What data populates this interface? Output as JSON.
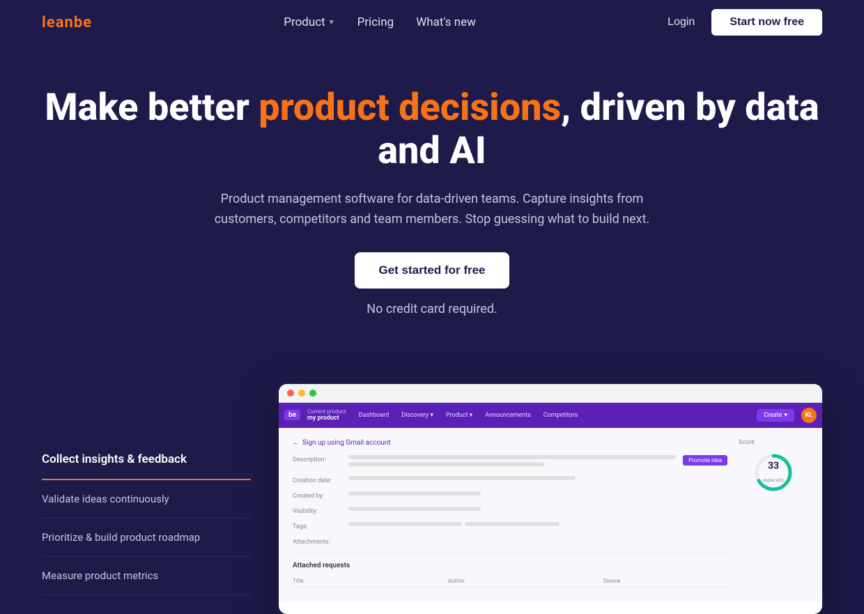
{
  "brand": {
    "name_part1": "lean",
    "name_part2": "be"
  },
  "nav": {
    "product_label": "Product",
    "pricing_label": "Pricing",
    "whats_new_label": "What's new",
    "login_label": "Login",
    "start_label": "Start now free"
  },
  "hero": {
    "headline_part1": "Make better ",
    "headline_highlight": "product decisions",
    "headline_part2": ", driven by data and AI",
    "subtext": "Product management software for data-driven teams. Capture insights from customers, competitors and team members. Stop guessing what to build next.",
    "cta_label": "Get started for free",
    "no_credit": "No credit card required."
  },
  "features": {
    "items": [
      {
        "label": "Collect insights & feedback",
        "active": true
      },
      {
        "label": "Validate ideas continuously",
        "active": false
      },
      {
        "label": "Prioritize & build product roadmap",
        "active": false
      },
      {
        "label": "Measure product metrics",
        "active": false
      }
    ]
  },
  "app_mockup": {
    "nav": {
      "logo": "be",
      "product_label": "Current product",
      "product_name": "my product",
      "items": [
        "Dashboard",
        "Discovery",
        "Product",
        "Announcements",
        "Competitors"
      ],
      "create_label": "Create",
      "avatar": "KL"
    },
    "form": {
      "back_label": "Sign up using Gmail account",
      "score_label": "Score",
      "score_value": "33",
      "score_more": "more info",
      "description_label": "Description:",
      "creation_date_label": "Creation date:",
      "created_by_label": "Created by:",
      "visibility_label": "Visibility:",
      "tags_label": "Tags:",
      "attachments_label": "Attachments:",
      "promote_label": "Promote idea",
      "requests_title": "Attached requests",
      "col_title": "Title",
      "col_author": "Author",
      "col_source": "Source"
    }
  },
  "colors": {
    "bg": "#1e1b4b",
    "accent": "#f97316",
    "purple": "#5b21b6",
    "purple_light": "#7c3aed"
  }
}
